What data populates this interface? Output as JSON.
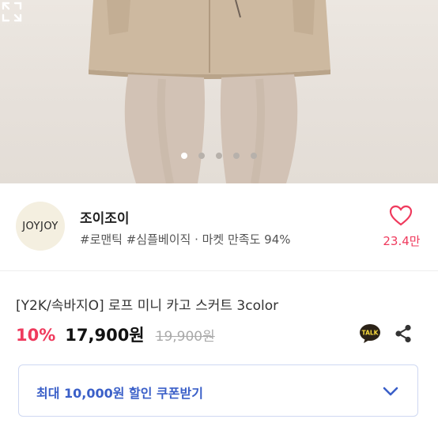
{
  "colors": {
    "accent_red": "#ef3a5d",
    "coupon_blue": "#3a5fc8"
  },
  "hero": {
    "image_slides": 5,
    "active_slide": 1,
    "expand_icon": "expand-icon"
  },
  "seller": {
    "logo_text": "JOYJOY",
    "name": "조이조이",
    "meta": "#로맨틱 #심플베이직 · 마켓 만족도 94%",
    "likes": "23.4만",
    "heart_icon": "heart-icon"
  },
  "product": {
    "title": "[Y2K/속바지O] 로프 미니 카고 스커트 3color",
    "discount": "10%",
    "price": "17,900원",
    "original_price": "19,900원",
    "talk_icon_text": "TALK",
    "share_icon": "share-icon"
  },
  "coupon": {
    "label": "최대 10,000원 할인 쿠폰받기",
    "chevron_icon": "chevron-down-icon"
  }
}
